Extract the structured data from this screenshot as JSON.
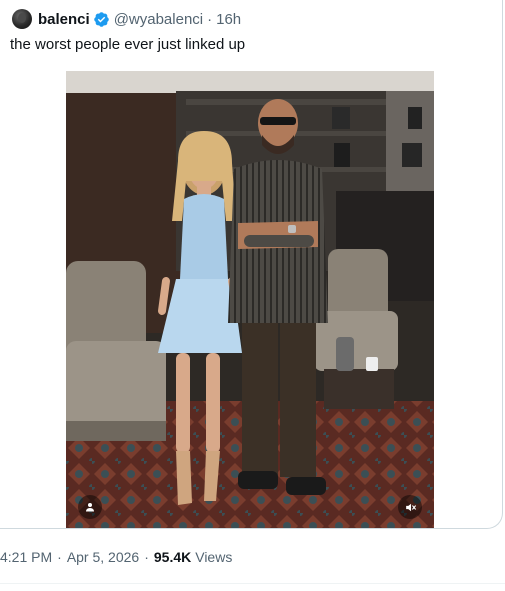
{
  "quoted_post": {
    "author": {
      "display_name": "balenci",
      "handle": "@wyabalenci",
      "verified": true,
      "avatar_icon": "avatar-image"
    },
    "separator": "·",
    "relative_time": "16h",
    "text": "the worst people ever just linked up",
    "media": {
      "type": "photo",
      "buttons": [
        "user-tag-icon",
        "mute-icon"
      ]
    }
  },
  "post_meta": {
    "time": "4:21 PM",
    "separator": "·",
    "date": "Apr 5, 2026",
    "views_count": "95.4K",
    "views_label": "Views"
  },
  "colors": {
    "text_primary": "#0f1419",
    "text_secondary": "#536471",
    "verified_blue": "#1d9bf0",
    "border": "#cfd9de"
  }
}
